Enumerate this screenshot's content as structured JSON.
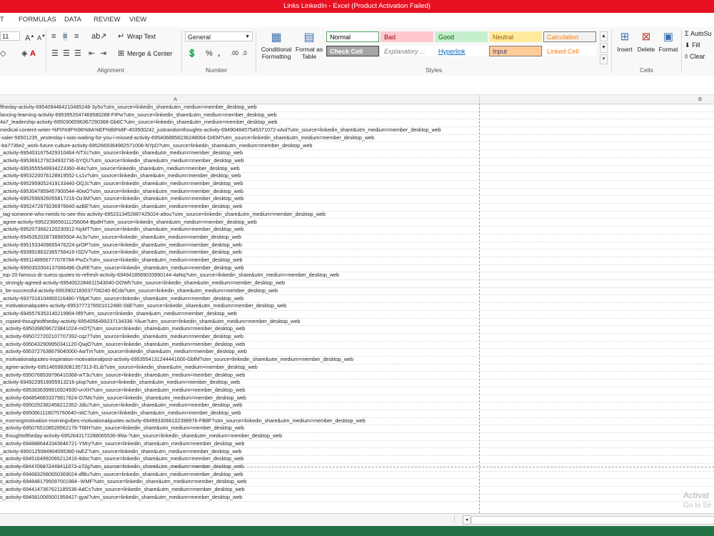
{
  "window": {
    "title": "Links LinkedIn -  Excel (Product Activation Failed)"
  },
  "tabs": [
    "T",
    "FORMULAS",
    "DATA",
    "REVIEW",
    "VIEW"
  ],
  "font": {
    "size": "11"
  },
  "alignment": {
    "label": "Alignment",
    "wrap_text": "Wrap Text",
    "merge_center": "Merge & Center"
  },
  "number": {
    "label": "Number",
    "format": "General",
    "percent": "%",
    "comma": ","
  },
  "styles": {
    "label": "Styles",
    "conditional": "Conditional\nFormatting",
    "format_table": "Format as\nTable",
    "cells": [
      {
        "name": "Normal",
        "bg": "#ffffff",
        "fg": "#000000",
        "border": "#4aa564"
      },
      {
        "name": "Bad",
        "bg": "#ffc7ce",
        "fg": "#9c0006",
        "border": "#ffc7ce"
      },
      {
        "name": "Good",
        "bg": "#c6efce",
        "fg": "#006100",
        "border": "#c6efce"
      },
      {
        "name": "Neutral",
        "bg": "#ffeb9c",
        "fg": "#9c5700",
        "border": "#ffeb9c"
      },
      {
        "name": "Calculation",
        "bg": "#f2f2f2",
        "fg": "#fa7d00",
        "border": "#7f7f7f"
      },
      {
        "name": "Check Cell",
        "bg": "#a5a5a5",
        "fg": "#ffffff",
        "border": "#3f3f3f"
      },
      {
        "name": "Explanatory ...",
        "bg": "#ffffff",
        "fg": "#7f7f7f",
        "border": "#ffffff"
      },
      {
        "name": "Hyperlink",
        "bg": "#ffffff",
        "fg": "#0563c1",
        "border": "#ffffff"
      },
      {
        "name": "Input",
        "bg": "#ffcc99",
        "fg": "#3f3f76",
        "border": "#7f7f7f"
      },
      {
        "name": "Linked Cell",
        "bg": "#ffffff",
        "fg": "#fa7d00",
        "border": "#ffffff"
      }
    ]
  },
  "cells_group": {
    "label": "Cells",
    "insert": "Insert",
    "delete": "Delete",
    "format": "Format"
  },
  "editing": {
    "autosum": "AutoSu",
    "fill": "Fill",
    "clear": "Clear"
  },
  "columns": {
    "a": "A",
    "b": "B"
  },
  "rows": [
    "ftheday-activity-6954094464210485248-3y5o?utm_source=linkedin_share&utm_medium=member_desktop_web",
    "lancing-learning-activity-6953952047469580288-FIPw?utm_source=linkedin_share&utm_medium=member_desktop_web",
    "4a7_leadership-activity-6950306596367290368-Gb6C?utm_source=linkedin_share&utm_medium=member_desktop_web",
    "medical-content-writer-%F0%9F%96%8A%EF%B8%8F-403500242_justrandomthoughts-activity-6949048457546371072-xAol?utm_source=linkedin_share&utm_medium=member_desktop_web",
    "-saler-56501235_yesterday-i-was-waiting-for-you-i-missed-activity-6954068858236248064-DrEM?utm_source=linkedin_share&utm_medium=member_desktop_web",
    "-ba7736e2_work-future-culture-activity-6952669364982571008-NYpD?utm_source=linkedin_share&utm_medium=member_desktop_web",
    "_activity-6954031675429310464-NTXc?utm_source=linkedin_share&utm_medium=member_desktop_web",
    "_activity-6953691279234932736-bYQU?utm_source=linkedin_share&utm_medium=member_desktop_web",
    "_activity-6953555549934223360-4I4s?utm_source=linkedin_share&utm_medium=member_desktop_web",
    "_activity-6953220076128919552-Ls1v?utm_source=linkedin_share&utm_medium=member_desktop_web",
    "_activity-6952959052419133440-OQJc?utm_source=linkedin_share&utm_medium=member_desktop_web",
    "_activity-6953047859457900544-40wO?utm_source=linkedin_share&utm_medium=member_desktop_web",
    "_activity-6952596926055817216-Oz3M?utm_source=linkedin_share&utm_medium=member_desktop_web",
    "_activity-6952472679236976640-azBE?utm_source=linkedin_share&utm_medium=member_desktop_web",
    "_tag-someone-who-needs-to-see-this-activity-6952313452887425024-a9ou?utm_source=linkedin_share&utm_medium=member_desktop_web",
    "_agree-activity-6952236659111256064-BpdH?utm_source=linkedin_share&utm_medium=member_desktop_web",
    "_activity-6952073662120230912-NyMT?utm_source=linkedin_share&utm_medium=member_desktop_web",
    "_activity-6945352028738965504-Ac3v?utm_source=linkedin_share&utm_medium=member_desktop_web",
    "_activity-6951533409655476224-prOP?utm_source=linkedin_share&utm_medium=member_desktop_web",
    "_activity-6939918632365756416-ISDV?utm_source=linkedin_share&utm_medium=member_desktop_web",
    "_activity-6951148956777078784-PwZx?utm_source=linkedin_share&utm_medium=member_desktop_web",
    "_activity-6950302004137066496-OuRE?utm_source=linkedin_share&utm_medium=member_desktop_web",
    "_top-20-famous-dr-suess-quotes-to-refresh-activity-6949418569033990144-4aNq?utm_source=linkedin_share&utm_medium=member_desktop_web",
    "s_strongly-agreed-activity-6954002284611543040-DOWh?utm_source=linkedin_share&utm_medium=member_desktop_web",
    "s_be-successful-activity-6953902183037706240-8Cda?utm_source=linkedin_share&utm_medium=member_desktop_web",
    "_activity-6937018104900116480-YMpK?utm_source=linkedin_share&utm_medium=member_desktop_web",
    "s_motivationalquotes-activity-6953777276501012480-StiE?utm_source=linkedin_share&utm_medium=member_desktop_web",
    "_activity-6945576353140219904-lIf9?utm_source=linkedin_share&utm_medium=member_desktop_web",
    "s_copied-thoughtoftheday-activity-6954056499237134336-YAue?utm_source=linkedin_share&utm_medium=member_desktop_web",
    "s_activity-6950398096723841024-mOTj?utm_source=linkedin_share&utm_medium=member_desktop_web",
    "s_activity-6950727202107707392-cqz7?utm_source=linkedin_share&utm_medium=member_desktop_web",
    "s_activity-6950432909950341120-QwjO?utm_source=linkedin_share&utm_medium=member_desktop_web",
    "s_activity-6953727638679040000-AwTm?utm_source=linkedin_share&utm_medium=member_desktop_web",
    "s_motivationalquotes-inspiration-motivationalpost-activity-6953554131244441600-GbfM?utm_source=linkedin_share&utm_medium=member_desktop_web",
    "s_agree-activity-6951465983081357313-ELib?utm_source=linkedin_share&utm_medium=member_desktop_web",
    "s_activity-6950768539796410368-wT3u?utm_source=linkedin_share&utm_medium=member_desktop_web",
    "_activity-6949229518955913216-pIop?utm_source=linkedin_share&utm_medium=member_desktop_web",
    "s_activity-6953636399916924930-vnXH?utm_source=linkedin_share&utm_medium=member_desktop_web",
    "s_activity-6948546833379917824-O7Ms?utm_source=linkedin_share&utm_medium=member_desktop_web",
    "s_activity-6950292382458212352-JdIu?utm_source=linkedin_share&utm_medium=member_desktop_web",
    "s_activity-6950661118075760640-ntiC?utm_source=linkedin_share&utm_medium=member_desktop_web",
    "s_morningmotivation-morningvibes-motivationalquotes-activity-6949933066102398976-FB8F?utm_source=linkedin_share&utm_medium=member_desktop_web",
    "s_activity-6950765108528562178-TIBH?utm_source=linkedin_share&utm_medium=member_desktop_web",
    "s_thoughtoftheday-activity-6952643172288065536-9Na-?utm_source=linkedin_share&utm_medium=member_desktop_web",
    "s_activity-6948886443343646721-YMry?utm_source=linkedin_share&utm_medium=member_desktop_web",
    "_activity-6950125084904095360-IwEZ?utm_source=linkedin_share&utm_medium=member_desktop_web",
    "s_activity-6945164992065212416-8doc?utm_source=linkedin_share&utm_medium=member_desktop_web",
    "s_activity-6944706972449411072-o72g?utm_source=linkedin_share&utm_medium=member_desktop_web",
    "s_activity-6946832580650369024-dfBu?utm_source=linkedin_share&utm_medium=member_desktop_web",
    "s_activity-6948481795097001984--WMF?utm_source=linkedin_share&utm_medium=member_desktop_web",
    "s_activity-6944147367621185536-AdCs?utm_source=linkedin_share&utm_medium=member_desktop_web",
    "s_activity-6945810065001959427-gyaI?utm_source=linkedin_share&utm_medium=member_desktop_web"
  ],
  "watermark": {
    "line1": "Activat",
    "line2": "Go to Se"
  }
}
